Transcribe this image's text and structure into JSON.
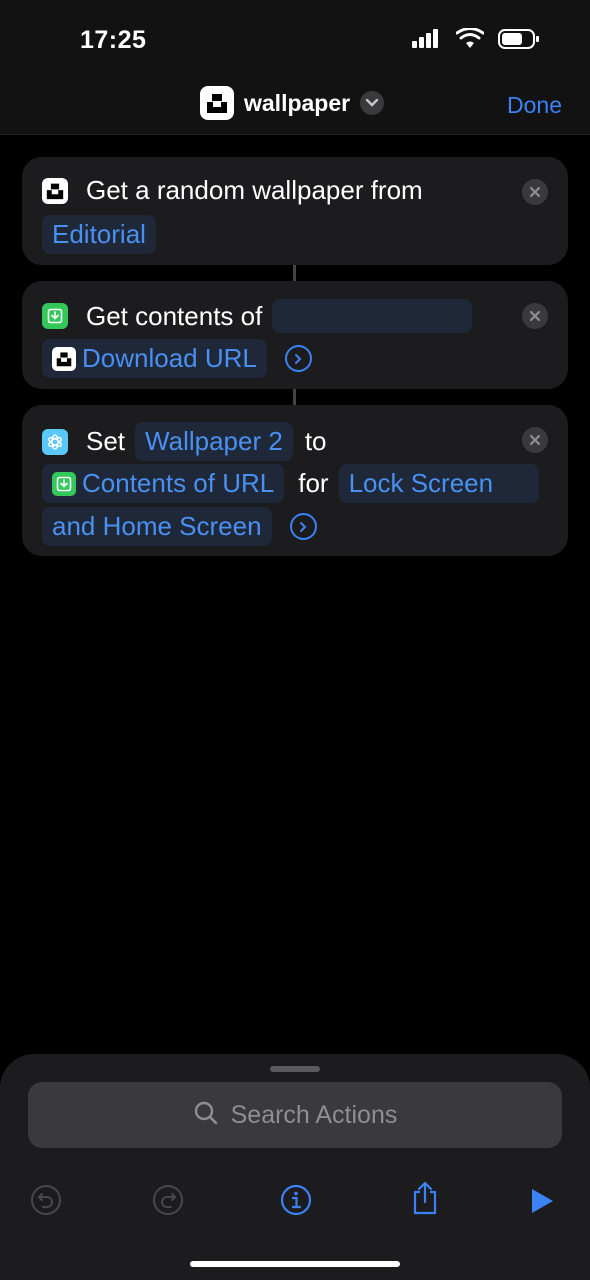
{
  "status_bar": {
    "time": "17:25"
  },
  "nav": {
    "title": "wallpaper",
    "done_label": "Done"
  },
  "actions": [
    {
      "text": "Get a random wallpaper from",
      "param": "Editorial"
    },
    {
      "text": "Get contents of",
      "param": "Download URL"
    },
    {
      "text_set": "Set",
      "param_wallpaper": "Wallpaper 2",
      "text_to": "to",
      "param_contents": "Contents of URL",
      "text_for": "for",
      "param_location_1": "Lock Screen",
      "param_location_2": "and Home Screen"
    }
  ],
  "search": {
    "placeholder": "Search Actions"
  },
  "colors": {
    "accent": "#3b82f6",
    "card": "#1c1c1e",
    "green": "#34c759",
    "pill_bg": "#1e2838"
  },
  "icons": [
    "unsplash-icon",
    "chevron-down-icon",
    "close-icon",
    "download-icon",
    "arrow-right-icon",
    "wallpaper-icon",
    "search-icon",
    "undo-icon",
    "redo-icon",
    "info-icon",
    "share-icon",
    "play-icon"
  ]
}
